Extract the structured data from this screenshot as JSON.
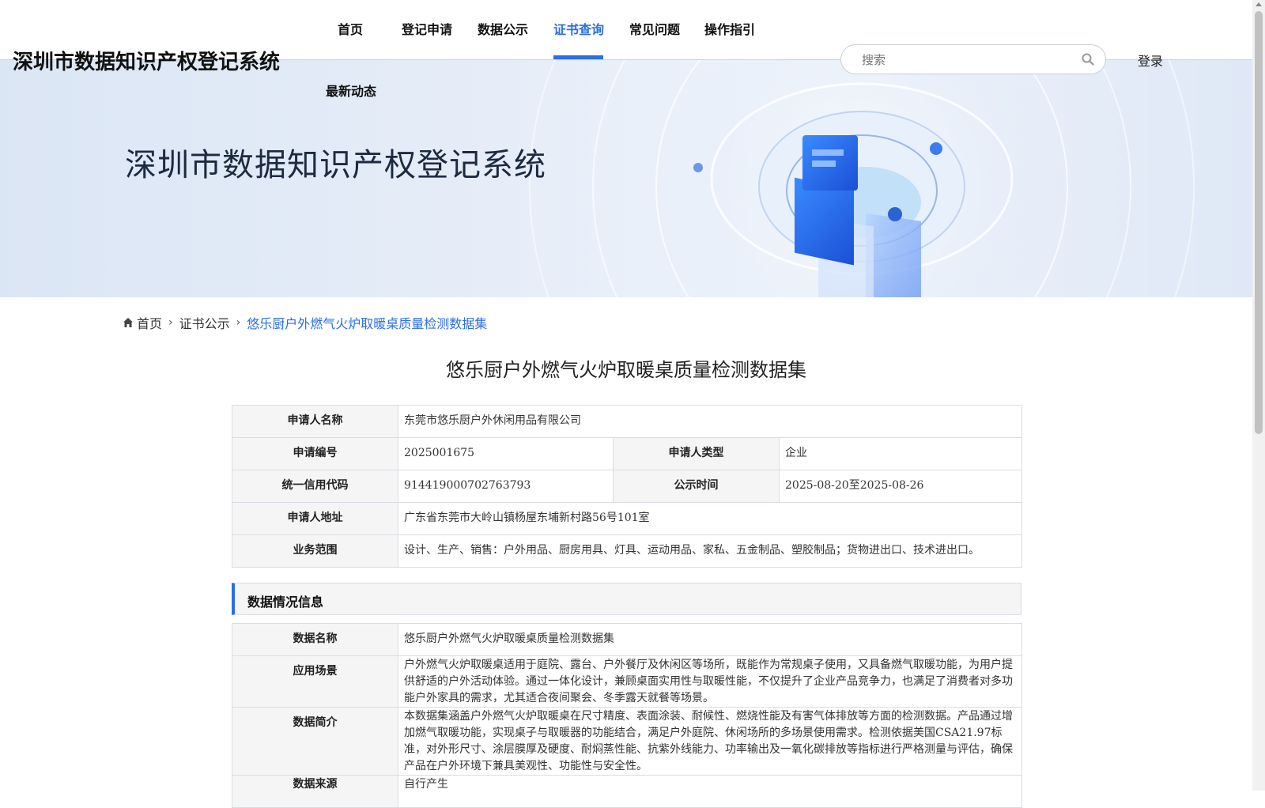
{
  "header": {
    "site_title": "深圳市数据知识产权登记系统",
    "nav": [
      {
        "label": "首页",
        "active": false
      },
      {
        "label": "登记申请",
        "active": false
      },
      {
        "label": "数据公示",
        "active": false
      },
      {
        "label": "证书查询",
        "active": true
      },
      {
        "label": "常见问题",
        "active": false
      },
      {
        "label": "操作指引",
        "active": false
      },
      {
        "label": "最新动态",
        "active": false
      }
    ],
    "search_placeholder": "搜索",
    "login_label": "登录"
  },
  "banner": {
    "title": "深圳市数据知识产权登记系统"
  },
  "breadcrumb": {
    "home": "首页",
    "level2": "证书公示",
    "current": "悠乐厨户外燃气火炉取暖桌质量检测数据集"
  },
  "page_title": "悠乐厨户外燃气火炉取暖桌质量检测数据集",
  "applicant": {
    "name_label": "申请人名称",
    "name_value": "东莞市悠乐厨户外休闲用品有限公司",
    "number_label": "申请编号",
    "number_value": "2025001675",
    "type_label": "申请人类型",
    "type_value": "企业",
    "credit_label": "统一信用代码",
    "credit_value": "914419000702763793",
    "publish_label": "公示时间",
    "publish_value": "2025-08-20至2025-08-26",
    "address_label": "申请人地址",
    "address_value": "广东省东莞市大岭山镇杨屋东埔新村路56号101室",
    "scope_label": "业务范围",
    "scope_value": "设计、生产、销售：户外用品、厨房用具、灯具、运动用品、家私、五金制品、塑胶制品；货物进出口、技术进出口。"
  },
  "data_section": {
    "heading": "数据情况信息",
    "data_name_label": "数据名称",
    "data_name_value": "悠乐厨户外燃气火炉取暖桌质量检测数据集",
    "scene_label": "应用场景",
    "scene_value": "户外燃气火炉取暖桌适用于庭院、露台、户外餐厅及休闲区等场所，既能作为常规桌子使用，又具备燃气取暖功能，为用户提供舒适的户外活动体验。通过一体化设计，兼顾桌面实用性与取暖性能，不仅提升了企业产品竞争力，也满足了消费者对多功能户外家具的需求，尤其适合夜间聚会、冬季露天就餐等场景。",
    "intro_label": "数据简介",
    "intro_value": "本数据集涵盖户外燃气火炉取暖桌在尺寸精度、表面涂装、耐候性、燃烧性能及有害气体排放等方面的检测数据。产品通过增加燃气取暖功能，实现桌子与取暖器的功能结合，满足户外庭院、休闲场所的多场景使用需求。检测依据美国CSA21.97标准，对外形尺寸、涂层膜厚及硬度、耐焖蒸性能、抗紫外线能力、功率输出及一氧化碳排放等指标进行严格测量与评估，确保产品在户外环境下兼具美观性、功能性与安全性。",
    "source_label": "数据来源",
    "source_value": "自行产生"
  }
}
